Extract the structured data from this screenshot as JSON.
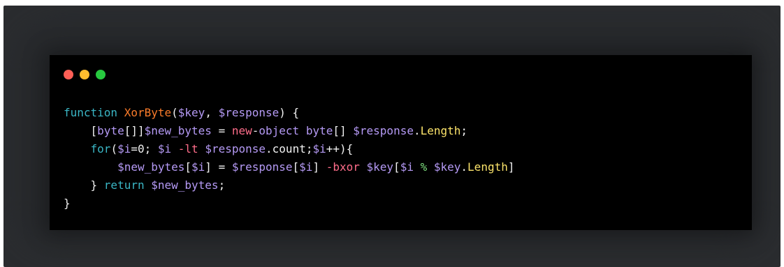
{
  "colors": {
    "dot_red": "#ff5f56",
    "dot_yellow": "#ffbd2e",
    "dot_green": "#27c93f",
    "keyword": "#3ab6c5",
    "function": "#fb7c2a",
    "variable": "#b59af5",
    "operator": "#ff6d8a",
    "member": "#fbe36a"
  },
  "window_controls": [
    {
      "name": "close",
      "icon": "red-circle-icon"
    },
    {
      "name": "minimize",
      "icon": "yellow-circle-icon"
    },
    {
      "name": "maximize",
      "icon": "green-circle-icon"
    }
  ],
  "code_lines": [
    [
      {
        "t": "function",
        "c": "keyword"
      },
      {
        "t": " ",
        "c": "plain"
      },
      {
        "t": "XorByte",
        "c": "func"
      },
      {
        "t": "(",
        "c": "plain"
      },
      {
        "t": "$key",
        "c": "var"
      },
      {
        "t": ", ",
        "c": "plain"
      },
      {
        "t": "$response",
        "c": "var"
      },
      {
        "t": ") {",
        "c": "plain"
      }
    ],
    [
      {
        "t": "    [",
        "c": "plain"
      },
      {
        "t": "byte",
        "c": "var"
      },
      {
        "t": "[]]",
        "c": "plain"
      },
      {
        "t": "$new_bytes",
        "c": "var"
      },
      {
        "t": " = ",
        "c": "plain"
      },
      {
        "t": "new",
        "c": "operator"
      },
      {
        "t": "-",
        "c": "plain"
      },
      {
        "t": "object",
        "c": "var"
      },
      {
        "t": " ",
        "c": "plain"
      },
      {
        "t": "byte",
        "c": "var"
      },
      {
        "t": "[] ",
        "c": "plain"
      },
      {
        "t": "$response",
        "c": "var"
      },
      {
        "t": ".",
        "c": "plain"
      },
      {
        "t": "Length",
        "c": "member"
      },
      {
        "t": ";",
        "c": "plain"
      }
    ],
    [
      {
        "t": "    ",
        "c": "plain"
      },
      {
        "t": "for",
        "c": "keyword"
      },
      {
        "t": "(",
        "c": "plain"
      },
      {
        "t": "$i",
        "c": "var"
      },
      {
        "t": "=0; ",
        "c": "plain"
      },
      {
        "t": "$i",
        "c": "var"
      },
      {
        "t": " ",
        "c": "plain"
      },
      {
        "t": "-lt",
        "c": "operator"
      },
      {
        "t": " ",
        "c": "plain"
      },
      {
        "t": "$response",
        "c": "var"
      },
      {
        "t": ".count;",
        "c": "plain"
      },
      {
        "t": "$i",
        "c": "var"
      },
      {
        "t": "++){",
        "c": "plain"
      }
    ],
    [
      {
        "t": "        ",
        "c": "plain"
      },
      {
        "t": "$new_bytes",
        "c": "var"
      },
      {
        "t": "[",
        "c": "plain"
      },
      {
        "t": "$i",
        "c": "var"
      },
      {
        "t": "] = ",
        "c": "plain"
      },
      {
        "t": "$response",
        "c": "var"
      },
      {
        "t": "[",
        "c": "plain"
      },
      {
        "t": "$i",
        "c": "var"
      },
      {
        "t": "] ",
        "c": "plain"
      },
      {
        "t": "-bxor",
        "c": "operator"
      },
      {
        "t": " ",
        "c": "plain"
      },
      {
        "t": "$key",
        "c": "var"
      },
      {
        "t": "[",
        "c": "plain"
      },
      {
        "t": "$i",
        "c": "var"
      },
      {
        "t": " ",
        "c": "plain"
      },
      {
        "t": "%",
        "c": "percent"
      },
      {
        "t": " ",
        "c": "plain"
      },
      {
        "t": "$key",
        "c": "var"
      },
      {
        "t": ".",
        "c": "plain"
      },
      {
        "t": "Length",
        "c": "member"
      },
      {
        "t": "]",
        "c": "plain"
      }
    ],
    [
      {
        "t": "    } ",
        "c": "plain"
      },
      {
        "t": "return",
        "c": "keyword"
      },
      {
        "t": " ",
        "c": "plain"
      },
      {
        "t": "$new_bytes",
        "c": "var"
      },
      {
        "t": ";",
        "c": "plain"
      }
    ],
    [
      {
        "t": "}",
        "c": "plain"
      }
    ]
  ]
}
